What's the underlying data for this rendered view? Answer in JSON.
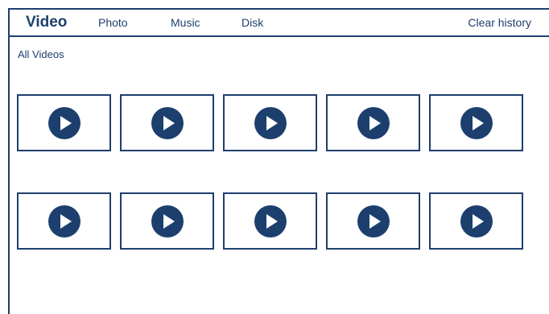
{
  "nav": {
    "tabs": [
      {
        "label": "Video",
        "active": true
      },
      {
        "label": "Photo",
        "active": false
      },
      {
        "label": "Music",
        "active": false
      },
      {
        "label": "Disk",
        "active": false
      }
    ],
    "clear_history_label": "Clear history"
  },
  "main": {
    "section_title": "All Videos",
    "tiles": [
      {
        "icon": "play-icon"
      },
      {
        "icon": "play-icon"
      },
      {
        "icon": "play-icon"
      },
      {
        "icon": "play-icon"
      },
      {
        "icon": "play-icon"
      },
      {
        "icon": "play-icon"
      },
      {
        "icon": "play-icon"
      },
      {
        "icon": "play-icon"
      },
      {
        "icon": "play-icon"
      },
      {
        "icon": "play-icon"
      }
    ]
  },
  "colors": {
    "accent": "#1d3f6e",
    "background": "#ffffff"
  }
}
